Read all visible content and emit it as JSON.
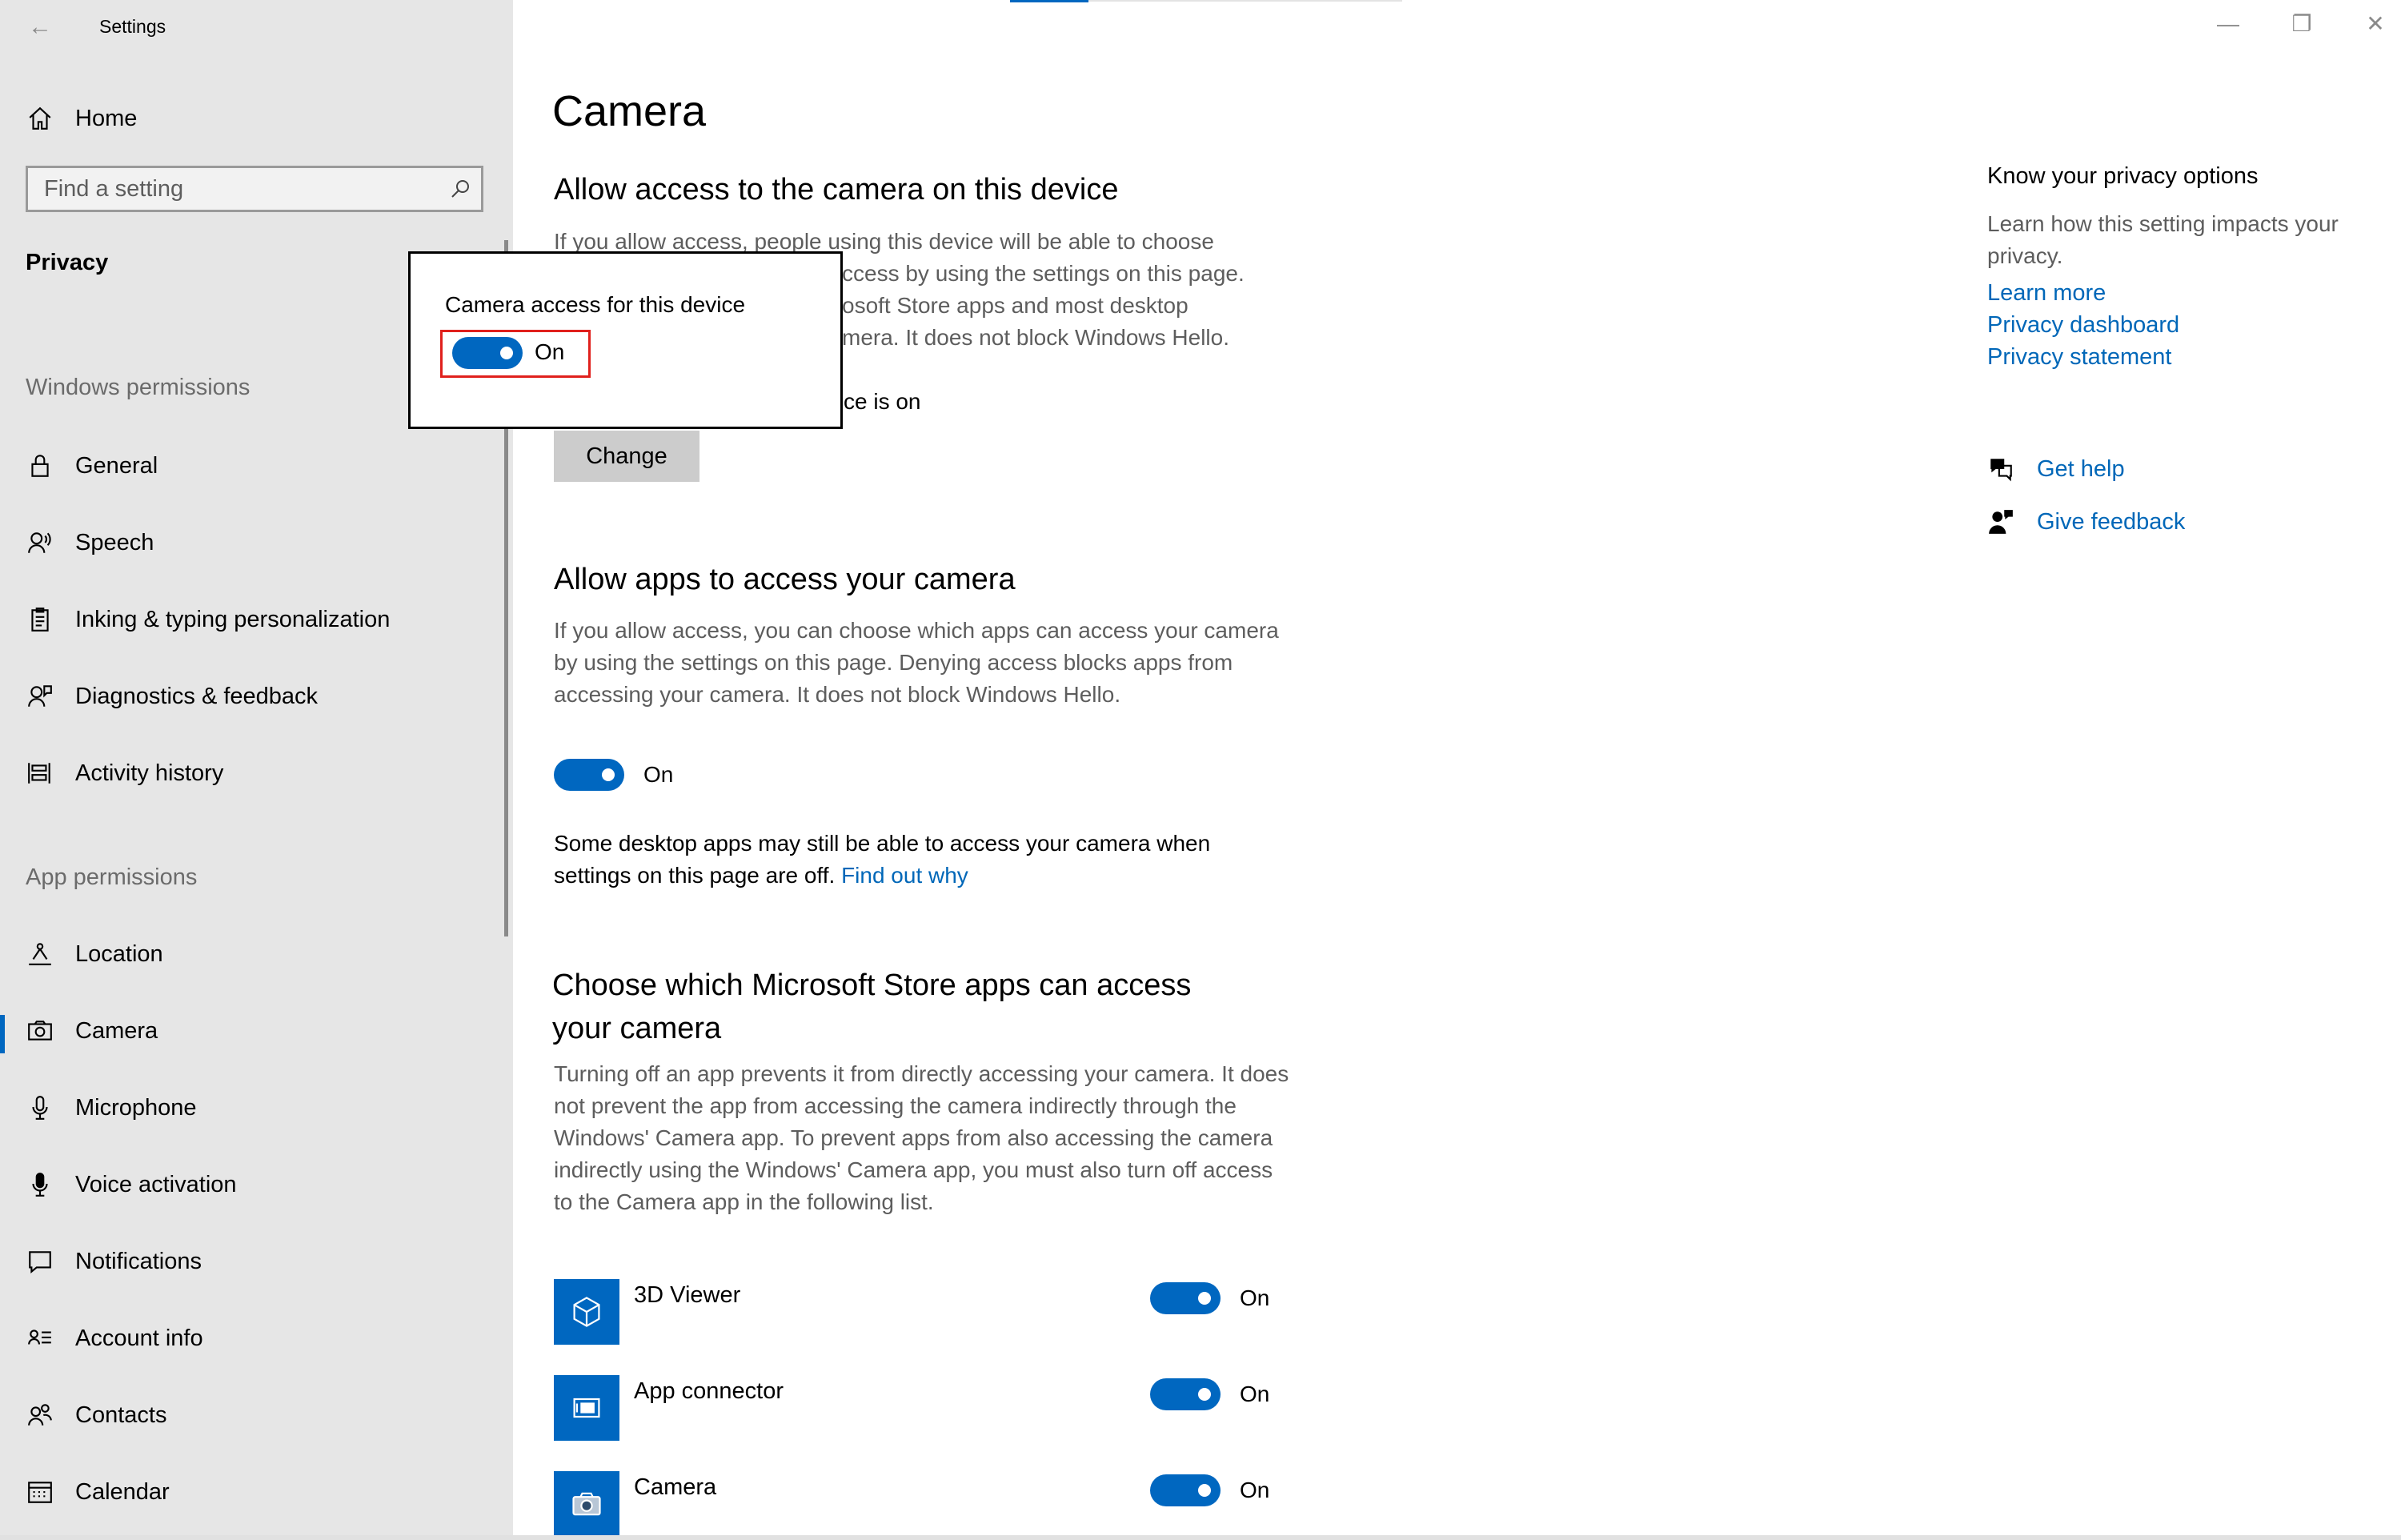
{
  "window": {
    "app_title": "Settings",
    "controls": {
      "minimize": "—",
      "restore": "❐",
      "close": "✕"
    }
  },
  "sidebar": {
    "home_label": "Home",
    "search_placeholder": "Find a setting",
    "section": "Privacy",
    "windows_permissions_label": "Windows permissions",
    "windows_permissions": [
      {
        "label": "General",
        "icon": "lock-icon"
      },
      {
        "label": "Speech",
        "icon": "speech-icon"
      },
      {
        "label": "Inking & typing personalization",
        "icon": "clipboard-icon"
      },
      {
        "label": "Diagnostics & feedback",
        "icon": "diagnostics-icon"
      },
      {
        "label": "Activity history",
        "icon": "activity-icon"
      }
    ],
    "app_permissions_label": "App permissions",
    "app_permissions": [
      {
        "label": "Location",
        "icon": "location-icon"
      },
      {
        "label": "Camera",
        "icon": "camera-icon",
        "active": true
      },
      {
        "label": "Microphone",
        "icon": "microphone-icon"
      },
      {
        "label": "Voice activation",
        "icon": "voice-icon"
      },
      {
        "label": "Notifications",
        "icon": "notification-icon"
      },
      {
        "label": "Account info",
        "icon": "account-info-icon"
      },
      {
        "label": "Contacts",
        "icon": "contacts-icon"
      },
      {
        "label": "Calendar",
        "icon": "calendar-icon"
      }
    ],
    "accent_color": "#0067c0"
  },
  "main": {
    "title": "Camera",
    "device_section": {
      "heading": "Allow access to the camera on this device",
      "desc_lines": [
        "If you allow access, people using this device will be able to choose",
        "ccess by using the settings on this page.",
        "osoft Store apps and most desktop",
        "mera. It does not block Windows Hello."
      ],
      "status": "ce is on",
      "change_button": "Change"
    },
    "popup": {
      "label": "Camera access for this device",
      "toggle_state": "On"
    },
    "apps_section": {
      "heading": "Allow apps to access your camera",
      "desc": "If you allow access, you can choose which apps can access your camera by using the settings on this page. Denying access blocks apps from accessing your camera. It does not block Windows Hello.",
      "toggle_state": "On",
      "note": "Some desktop apps may still be able to access your camera when settings on this page are off.",
      "note_link": "Find out why"
    },
    "store_section": {
      "heading_line1": "Choose which Microsoft Store apps can access",
      "heading_line2": "your camera",
      "desc": "Turning off an app prevents it from directly accessing your camera. It does not prevent the app from accessing the camera indirectly through the Windows' Camera app. To prevent apps from also accessing the camera indirectly using the Windows' Camera app, you must also turn off access to the Camera app in the following list.",
      "apps": [
        {
          "name": "3D Viewer",
          "icon": "cube-icon",
          "state": "On"
        },
        {
          "name": "App connector",
          "icon": "app-connector-icon",
          "state": "On"
        },
        {
          "name": "Camera",
          "icon": "camera-app-icon",
          "state": "On"
        }
      ]
    }
  },
  "right_column": {
    "title": "Know your privacy options",
    "desc": "Learn how this setting impacts your privacy.",
    "links": [
      "Learn more",
      "Privacy dashboard",
      "Privacy statement"
    ],
    "get_help": "Get help",
    "give_feedback": "Give feedback",
    "link_color": "#0067b8"
  }
}
